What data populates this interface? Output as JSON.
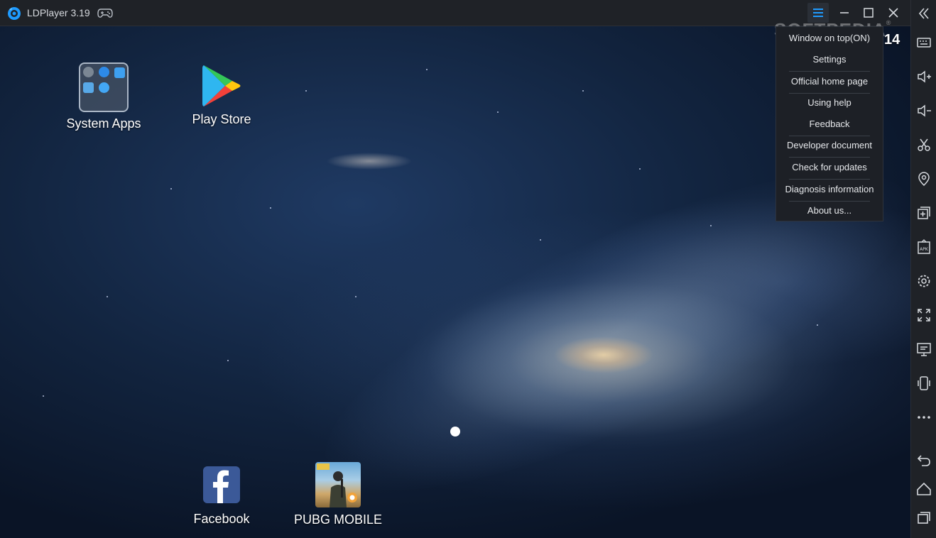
{
  "window": {
    "title": "LDPlayer 3.19"
  },
  "watermark": "SOFTPEDIA",
  "watermark_mark": "®",
  "fps_counter": "14",
  "desktop": {
    "apps": [
      {
        "label": "System Apps",
        "icon": "folder-icon"
      },
      {
        "label": "Play Store",
        "icon": "play-store-icon"
      },
      {
        "label": "Facebook",
        "icon": "facebook-icon"
      },
      {
        "label": "PUBG MOBILE",
        "icon": "pubg-icon"
      }
    ]
  },
  "menu": {
    "items": [
      "Window on top(ON)",
      "Settings",
      "Official home page",
      "Using help",
      "Feedback",
      "Developer document",
      "Check for updates",
      "Diagnosis information",
      "About us..."
    ]
  },
  "sidebar": {
    "items": [
      "collapse-icon",
      "keyboard-icon",
      "volume-up-icon",
      "volume-down-icon",
      "scissors-icon",
      "location-icon",
      "add-window-icon",
      "apk-icon",
      "settings-icon",
      "fullscreen-icon",
      "monitor-icon",
      "shake-icon",
      "more-icon",
      "back-icon",
      "home-icon",
      "recents-icon"
    ]
  },
  "colors": {
    "titlebar": "#1f2227",
    "menu_bg": "#1d2026",
    "accent": "#1e9bff"
  }
}
